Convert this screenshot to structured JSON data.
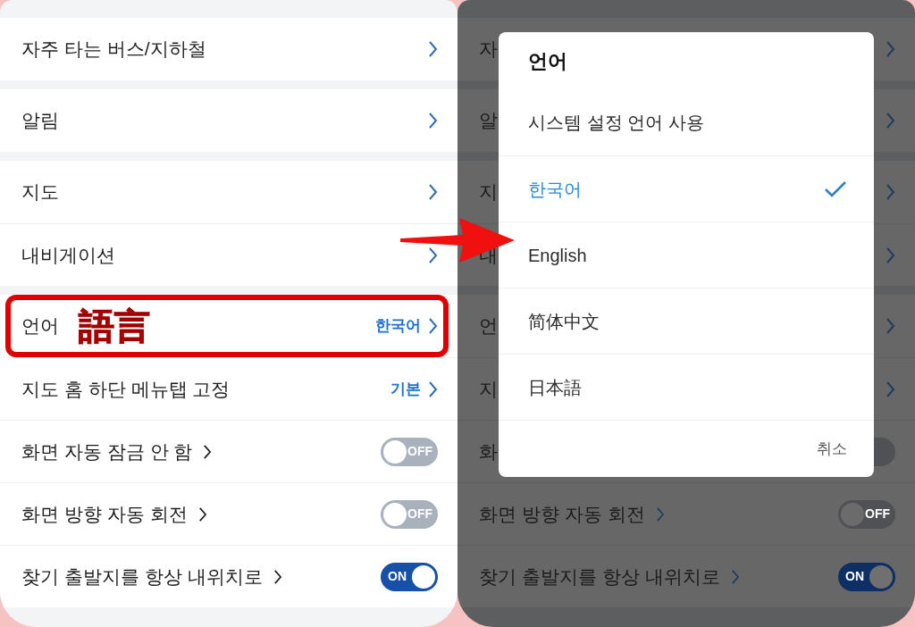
{
  "annotation": {
    "label": "語言"
  },
  "settings": {
    "groups": [
      {
        "rows": [
          {
            "kind": "link",
            "label": "자주 타는 버스/지하철"
          }
        ]
      },
      {
        "rows": [
          {
            "kind": "link",
            "label": "알림"
          }
        ]
      },
      {
        "rows": [
          {
            "kind": "link",
            "label": "지도"
          },
          {
            "kind": "link",
            "label": "내비게이션"
          }
        ]
      },
      {
        "rows": [
          {
            "kind": "value",
            "label": "언어",
            "value": "한국어",
            "highlighted": true
          },
          {
            "kind": "value",
            "label": "지도 홈 하단 메뉴탭 고정",
            "value": "기본"
          },
          {
            "kind": "toggle",
            "label": "화면 자동 잠금 안 함",
            "on": false,
            "toggle_text": "OFF"
          },
          {
            "kind": "toggle",
            "label": "화면 방향 자동 회전",
            "on": false,
            "toggle_text": "OFF"
          },
          {
            "kind": "toggle",
            "label": "찾기 출발지를 항상 내위치로",
            "on": true,
            "toggle_text": "ON"
          }
        ]
      }
    ]
  },
  "dimmed_settings": {
    "groups": [
      {
        "rows": [
          {
            "kind": "link",
            "label": "자"
          }
        ]
      },
      {
        "rows": [
          {
            "kind": "link",
            "label": "알"
          }
        ]
      },
      {
        "rows": [
          {
            "kind": "link",
            "label": "지"
          },
          {
            "kind": "link",
            "label": "내"
          }
        ]
      },
      {
        "rows": [
          {
            "kind": "link",
            "label": "언"
          },
          {
            "kind": "link",
            "label": "지"
          },
          {
            "kind": "toggle",
            "label": "화",
            "on": false
          },
          {
            "kind": "toggle",
            "label": "화면 방향 자동 회전",
            "on": false,
            "toggle_text": "OFF"
          },
          {
            "kind": "toggle",
            "label": "찾기 출발지를 항상 내위치로",
            "on": true,
            "toggle_text": "ON"
          }
        ]
      }
    ]
  },
  "language_dialog": {
    "title": "언어",
    "options": [
      {
        "label": "시스템 설정 언어 사용",
        "selected": false
      },
      {
        "label": "한국어",
        "selected": true
      },
      {
        "label": "English",
        "selected": false
      },
      {
        "label": "简体中文",
        "selected": false
      },
      {
        "label": "日本語",
        "selected": false
      }
    ],
    "cancel": "취소"
  }
}
